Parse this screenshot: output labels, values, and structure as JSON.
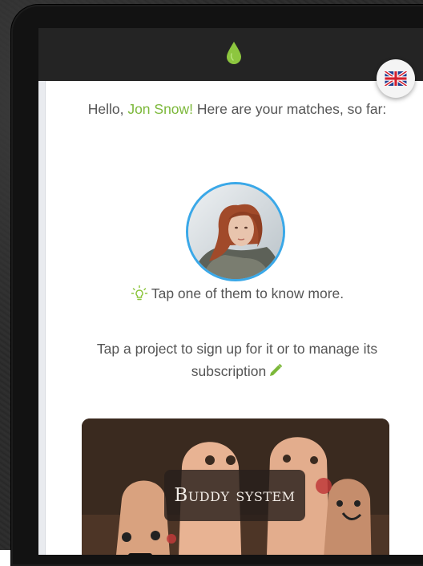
{
  "header": {
    "logo_icon": "leaf-drop-icon",
    "brand_color": "#8dc63f",
    "language_icon": "uk-flag-icon"
  },
  "greeting": {
    "prefix": "Hello, ",
    "name": "Jon Snow!",
    "suffix": " Here are your matches, so far:"
  },
  "matches": [
    {
      "avatar_icon": "match-avatar-photo"
    }
  ],
  "tip": {
    "icon": "lightbulb-icon",
    "text": "Tap one of them to know more."
  },
  "instructions": {
    "text": "Tap a project to sign up for it or to manage its subscription",
    "icon": "pencil-icon"
  },
  "projects": [
    {
      "title": "Buddy system"
    }
  ],
  "colors": {
    "accent": "#7cb83a",
    "avatar_ring": "#3aa8e8",
    "app_bar": "#242424"
  }
}
